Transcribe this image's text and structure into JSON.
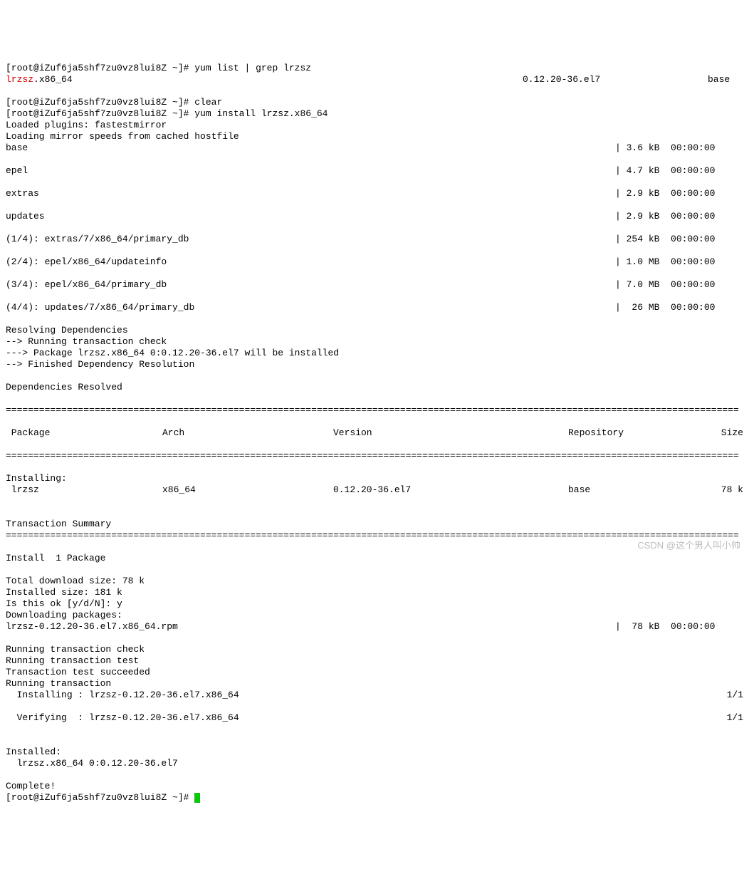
{
  "prompt1": "[root@iZuf6ja5shf7zu0vz8lui8Z ~]# ",
  "cmd1": "yum list | grep lrzsz",
  "listing": {
    "pkg": "lrzsz",
    "suffix": ".x86_64",
    "ver": "0.12.20-36.el7",
    "repo": "base"
  },
  "cmd2": "clear",
  "cmd3": "yum install lrzsz.x86_64",
  "loading1": "Loaded plugins: fastestmirror",
  "loading2": "Loading mirror speeds from cached hostfile",
  "repos": [
    {
      "name": "base",
      "size": "3.6 kB",
      "time": "00:00:00"
    },
    {
      "name": "epel",
      "size": "4.7 kB",
      "time": "00:00:00"
    },
    {
      "name": "extras",
      "size": "2.9 kB",
      "time": "00:00:00"
    },
    {
      "name": "updates",
      "size": "2.9 kB",
      "time": "00:00:00"
    }
  ],
  "fetches": [
    {
      "name": "(1/4): extras/7/x86_64/primary_db",
      "size": "254 kB",
      "time": "00:00:00"
    },
    {
      "name": "(2/4): epel/x86_64/updateinfo",
      "size": "1.0 MB",
      "time": "00:00:00"
    },
    {
      "name": "(3/4): epel/x86_64/primary_db",
      "size": "7.0 MB",
      "time": "00:00:00"
    },
    {
      "name": "(4/4): updates/7/x86_64/primary_db",
      "size": " 26 MB",
      "time": "00:00:00"
    }
  ],
  "resolve": {
    "l1": "Resolving Dependencies",
    "l2": "--> Running transaction check",
    "l3": "---> Package lrzsz.x86_64 0:0.12.20-36.el7 will be installed",
    "l4": "--> Finished Dependency Resolution",
    "l5": "Dependencies Resolved"
  },
  "hdr": {
    "pkg": " Package",
    "arch": "Arch",
    "ver": "Version",
    "repo": "Repository",
    "size": "Size"
  },
  "installing_label": "Installing:",
  "pkgrow": {
    "pkg": " lrzsz",
    "arch": "x86_64",
    "ver": "0.12.20-36.el7",
    "repo": "base",
    "size": "78 k"
  },
  "summary_label": "Transaction Summary",
  "install_count": "Install  1 Package",
  "dlsize": "Total download size: 78 k",
  "instsize": "Installed size: 181 k",
  "confirm": "Is this ok [y/d/N]: y",
  "dlpkg": "Downloading packages:",
  "rpm": {
    "name": "lrzsz-0.12.20-36.el7.x86_64.rpm",
    "size": " 78 kB",
    "time": "00:00:00"
  },
  "tx": {
    "l1": "Running transaction check",
    "l2": "Running transaction test",
    "l3": "Transaction test succeeded",
    "l4": "Running transaction"
  },
  "step_install": "  Installing : lrzsz-0.12.20-36.el7.x86_64",
  "step_verify": "  Verifying  : lrzsz-0.12.20-36.el7.x86_64",
  "step_progress": "1/1",
  "installed_label": "Installed:",
  "installed_pkg": "  lrzsz.x86_64 0:0.12.20-36.el7",
  "complete": "Complete!",
  "watermark": "CSDN @这个男人叫小帅"
}
